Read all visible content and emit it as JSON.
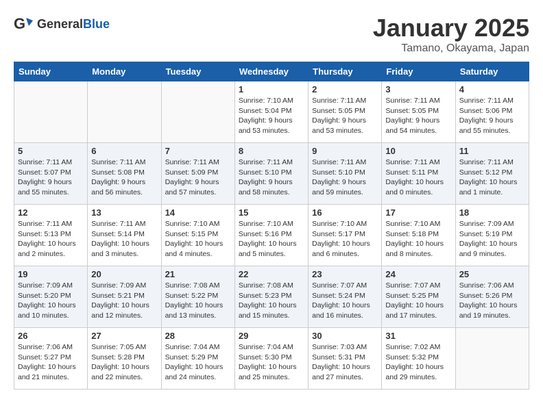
{
  "header": {
    "logo_general": "General",
    "logo_blue": "Blue",
    "month": "January 2025",
    "location": "Tamano, Okayama, Japan"
  },
  "weekdays": [
    "Sunday",
    "Monday",
    "Tuesday",
    "Wednesday",
    "Thursday",
    "Friday",
    "Saturday"
  ],
  "weeks": [
    [
      {
        "day": "",
        "info": ""
      },
      {
        "day": "",
        "info": ""
      },
      {
        "day": "",
        "info": ""
      },
      {
        "day": "1",
        "info": "Sunrise: 7:10 AM\nSunset: 5:04 PM\nDaylight: 9 hours\nand 53 minutes."
      },
      {
        "day": "2",
        "info": "Sunrise: 7:11 AM\nSunset: 5:05 PM\nDaylight: 9 hours\nand 53 minutes."
      },
      {
        "day": "3",
        "info": "Sunrise: 7:11 AM\nSunset: 5:05 PM\nDaylight: 9 hours\nand 54 minutes."
      },
      {
        "day": "4",
        "info": "Sunrise: 7:11 AM\nSunset: 5:06 PM\nDaylight: 9 hours\nand 55 minutes."
      }
    ],
    [
      {
        "day": "5",
        "info": "Sunrise: 7:11 AM\nSunset: 5:07 PM\nDaylight: 9 hours\nand 55 minutes."
      },
      {
        "day": "6",
        "info": "Sunrise: 7:11 AM\nSunset: 5:08 PM\nDaylight: 9 hours\nand 56 minutes."
      },
      {
        "day": "7",
        "info": "Sunrise: 7:11 AM\nSunset: 5:09 PM\nDaylight: 9 hours\nand 57 minutes."
      },
      {
        "day": "8",
        "info": "Sunrise: 7:11 AM\nSunset: 5:10 PM\nDaylight: 9 hours\nand 58 minutes."
      },
      {
        "day": "9",
        "info": "Sunrise: 7:11 AM\nSunset: 5:10 PM\nDaylight: 9 hours\nand 59 minutes."
      },
      {
        "day": "10",
        "info": "Sunrise: 7:11 AM\nSunset: 5:11 PM\nDaylight: 10 hours\nand 0 minutes."
      },
      {
        "day": "11",
        "info": "Sunrise: 7:11 AM\nSunset: 5:12 PM\nDaylight: 10 hours\nand 1 minute."
      }
    ],
    [
      {
        "day": "12",
        "info": "Sunrise: 7:11 AM\nSunset: 5:13 PM\nDaylight: 10 hours\nand 2 minutes."
      },
      {
        "day": "13",
        "info": "Sunrise: 7:11 AM\nSunset: 5:14 PM\nDaylight: 10 hours\nand 3 minutes."
      },
      {
        "day": "14",
        "info": "Sunrise: 7:10 AM\nSunset: 5:15 PM\nDaylight: 10 hours\nand 4 minutes."
      },
      {
        "day": "15",
        "info": "Sunrise: 7:10 AM\nSunset: 5:16 PM\nDaylight: 10 hours\nand 5 minutes."
      },
      {
        "day": "16",
        "info": "Sunrise: 7:10 AM\nSunset: 5:17 PM\nDaylight: 10 hours\nand 6 minutes."
      },
      {
        "day": "17",
        "info": "Sunrise: 7:10 AM\nSunset: 5:18 PM\nDaylight: 10 hours\nand 8 minutes."
      },
      {
        "day": "18",
        "info": "Sunrise: 7:09 AM\nSunset: 5:19 PM\nDaylight: 10 hours\nand 9 minutes."
      }
    ],
    [
      {
        "day": "19",
        "info": "Sunrise: 7:09 AM\nSunset: 5:20 PM\nDaylight: 10 hours\nand 10 minutes."
      },
      {
        "day": "20",
        "info": "Sunrise: 7:09 AM\nSunset: 5:21 PM\nDaylight: 10 hours\nand 12 minutes."
      },
      {
        "day": "21",
        "info": "Sunrise: 7:08 AM\nSunset: 5:22 PM\nDaylight: 10 hours\nand 13 minutes."
      },
      {
        "day": "22",
        "info": "Sunrise: 7:08 AM\nSunset: 5:23 PM\nDaylight: 10 hours\nand 15 minutes."
      },
      {
        "day": "23",
        "info": "Sunrise: 7:07 AM\nSunset: 5:24 PM\nDaylight: 10 hours\nand 16 minutes."
      },
      {
        "day": "24",
        "info": "Sunrise: 7:07 AM\nSunset: 5:25 PM\nDaylight: 10 hours\nand 17 minutes."
      },
      {
        "day": "25",
        "info": "Sunrise: 7:06 AM\nSunset: 5:26 PM\nDaylight: 10 hours\nand 19 minutes."
      }
    ],
    [
      {
        "day": "26",
        "info": "Sunrise: 7:06 AM\nSunset: 5:27 PM\nDaylight: 10 hours\nand 21 minutes."
      },
      {
        "day": "27",
        "info": "Sunrise: 7:05 AM\nSunset: 5:28 PM\nDaylight: 10 hours\nand 22 minutes."
      },
      {
        "day": "28",
        "info": "Sunrise: 7:04 AM\nSunset: 5:29 PM\nDaylight: 10 hours\nand 24 minutes."
      },
      {
        "day": "29",
        "info": "Sunrise: 7:04 AM\nSunset: 5:30 PM\nDaylight: 10 hours\nand 25 minutes."
      },
      {
        "day": "30",
        "info": "Sunrise: 7:03 AM\nSunset: 5:31 PM\nDaylight: 10 hours\nand 27 minutes."
      },
      {
        "day": "31",
        "info": "Sunrise: 7:02 AM\nSunset: 5:32 PM\nDaylight: 10 hours\nand 29 minutes."
      },
      {
        "day": "",
        "info": ""
      }
    ]
  ]
}
